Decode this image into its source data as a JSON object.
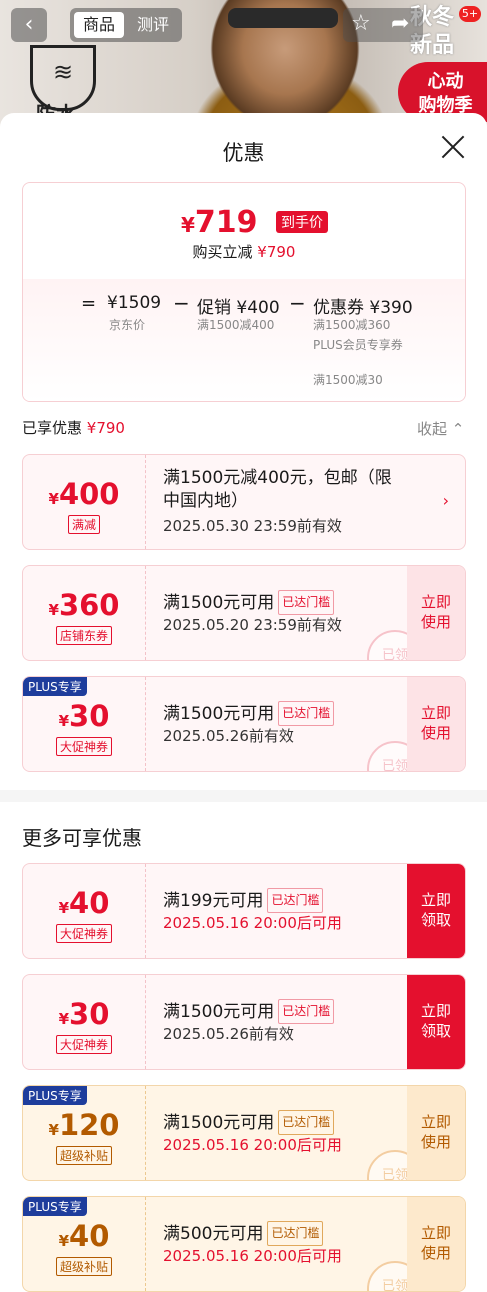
{
  "header": {
    "tab_product": "商品",
    "tab_review": "测评",
    "notif_count": "5+",
    "waterproof": "防水",
    "season_line1": "秋冬",
    "season_line2": "新品",
    "promo_line1": "心动",
    "promo_line2": "购物季"
  },
  "sheet": {
    "title": "优惠"
  },
  "summary": {
    "currency": "¥",
    "final_price": "719",
    "final_tag": "到手价",
    "reduce_label": "购买立减",
    "reduce_amount": "¥790",
    "eq": "=",
    "jd_price": "¥1509",
    "jd_label": "京东价",
    "minus": "−",
    "promo": "促销 ¥400",
    "promo_sub": "满1500减400",
    "coupon": "优惠券 ¥390",
    "coupon_sub1": "满1500减360",
    "coupon_sub2": "PLUS会员专享券",
    "coupon_sub3": "满1500减30"
  },
  "enjoyed": {
    "label": "已享优惠",
    "amount": "¥790",
    "collapse": "收起"
  },
  "coupons": [
    {
      "cur": "¥",
      "amount": "400",
      "tag": "满减",
      "line1": "满1500元减400元，包邮（限",
      "line2": "中国内地）",
      "date": "2025.05.30 23:59前有效"
    },
    {
      "cur": "¥",
      "amount": "360",
      "tag": "店铺东券",
      "text": "满1500元可用",
      "reached": "已达门槛",
      "date": "2025.05.20 23:59前有效",
      "btn1": "立即",
      "btn2": "使用",
      "stamp": "已领"
    },
    {
      "plus": "PLUS专享",
      "cur": "¥",
      "amount": "30",
      "tag": "大促神券",
      "text": "满1500元可用",
      "reached": "已达门槛",
      "date": "2025.05.26前有效",
      "btn1": "立即",
      "btn2": "使用",
      "stamp": "已领"
    }
  ],
  "more": {
    "title": "更多可享优惠"
  },
  "more_coupons": [
    {
      "cur": "¥",
      "amount": "40",
      "tag": "大促神券",
      "text": "满199元可用",
      "reached": "已达门槛",
      "date": "2025.05.16 20:00后可用",
      "btn1": "立即",
      "btn2": "领取"
    },
    {
      "cur": "¥",
      "amount": "30",
      "tag": "大促神券",
      "text": "满1500元可用",
      "reached": "已达门槛",
      "date": "2025.05.26前有效",
      "btn1": "立即",
      "btn2": "领取"
    },
    {
      "plus": "PLUS专享",
      "cur": "¥",
      "amount": "120",
      "tag": "超级补贴",
      "text": "满1500元可用",
      "reached": "已达门槛",
      "date": "2025.05.16 20:00后可用",
      "btn1": "立即",
      "btn2": "使用",
      "stamp": "已领"
    },
    {
      "plus": "PLUS专享",
      "cur": "¥",
      "amount": "40",
      "tag": "超级补贴",
      "text": "满500元可用",
      "reached": "已达门槛",
      "date": "2025.05.16 20:00后可用",
      "btn1": "立即",
      "btn2": "使用",
      "stamp": "已领"
    }
  ],
  "colors": {
    "accent": "#e4102e",
    "plus_badge": "#1e3d9c",
    "gold": "#b25a00"
  }
}
